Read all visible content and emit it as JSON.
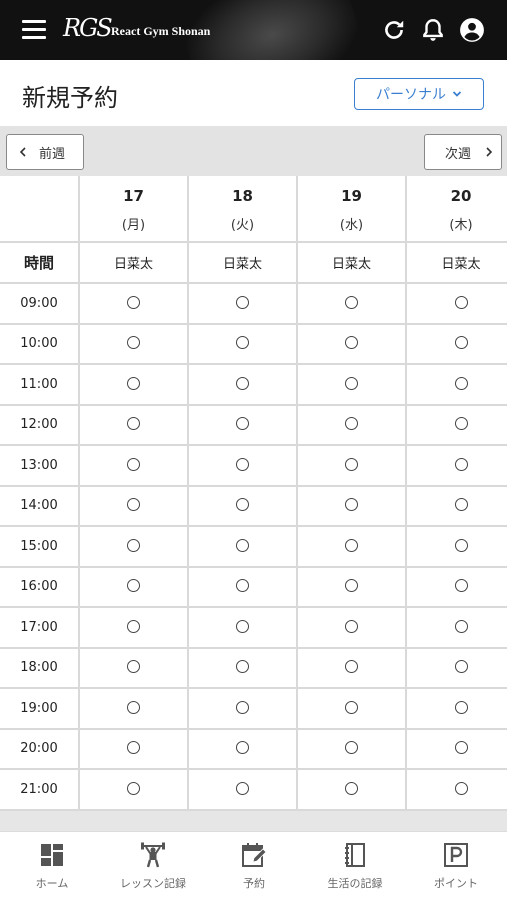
{
  "header": {
    "logo_mark": "RGS",
    "brand": "React Gym Shonan",
    "icons": [
      "menu-icon",
      "refresh-icon",
      "bell-icon",
      "account-icon"
    ]
  },
  "title_row": {
    "title": "新規予約",
    "type_select": "パーソナル"
  },
  "week_nav": {
    "prev_label": "前週",
    "next_label": "次週"
  },
  "schedule": {
    "time_header": "時間",
    "days": [
      {
        "day": "17",
        "dow": "(月)",
        "trainer": "日菜太"
      },
      {
        "day": "18",
        "dow": "(火)",
        "trainer": "日菜太"
      },
      {
        "day": "19",
        "dow": "(水)",
        "trainer": "日菜太"
      },
      {
        "day": "20",
        "dow": "(木)",
        "trainer": "日菜太"
      }
    ],
    "times": [
      "09:00",
      "10:00",
      "11:00",
      "12:00",
      "13:00",
      "14:00",
      "15:00",
      "16:00",
      "17:00",
      "18:00",
      "19:00",
      "20:00",
      "21:00"
    ],
    "slot_status": "available"
  },
  "bottom_nav": {
    "items": [
      {
        "label": "ホーム",
        "icon": "dashboard-icon"
      },
      {
        "label": "レッスン記録",
        "icon": "weightlifter-icon"
      },
      {
        "label": "予約",
        "icon": "calendar-edit-icon"
      },
      {
        "label": "生活の記録",
        "icon": "notebook-icon"
      },
      {
        "label": "ポイント",
        "icon": "parking-p-icon"
      }
    ]
  },
  "colors": {
    "header_bg": "#111111",
    "accent": "#3b7fd1",
    "grid_line": "#d9d9d9"
  }
}
